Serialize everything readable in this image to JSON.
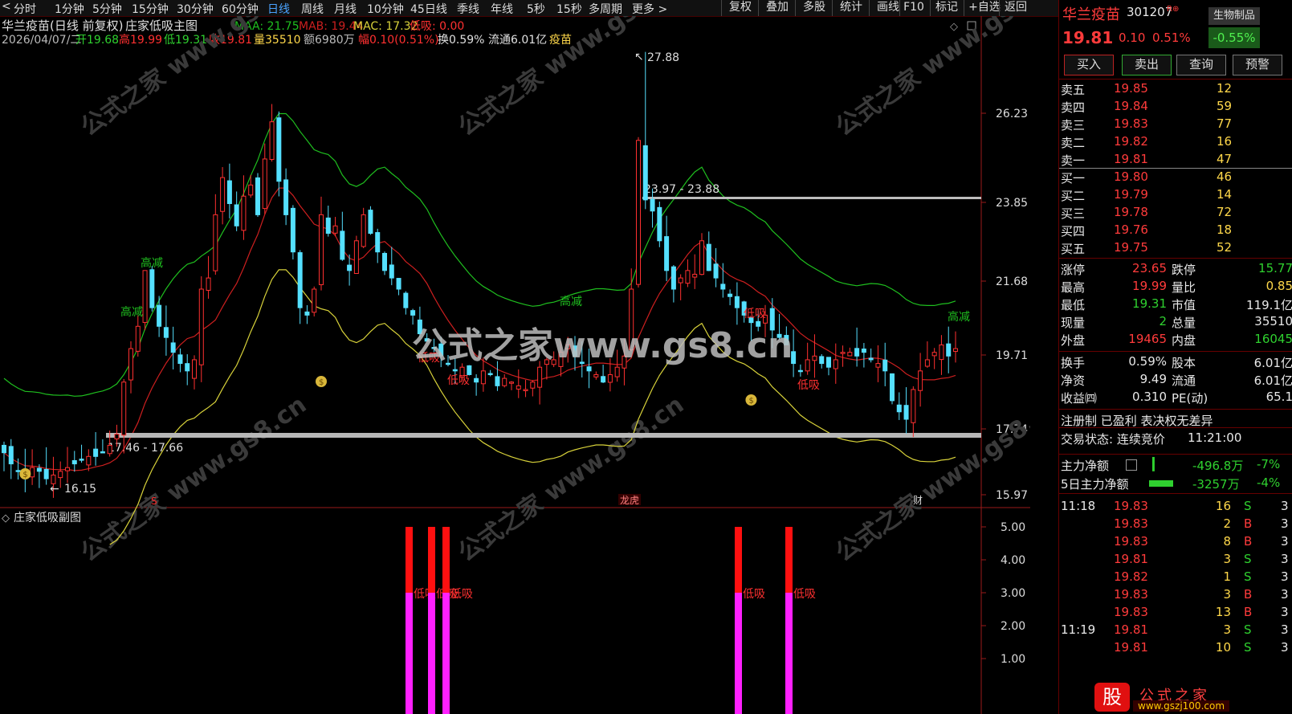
{
  "toolbar": {
    "left_icon": "<",
    "tabs": [
      "分时",
      "1分钟",
      "5分钟",
      "15分钟",
      "30分钟",
      "60分钟",
      "日线",
      "周线",
      "月线",
      "10分钟",
      "45日线",
      "季线",
      "年线",
      "5秒",
      "15秒",
      "多周期",
      "更多 >"
    ],
    "active_tab": "日线",
    "right_buttons": [
      "复权",
      "叠加",
      "多股",
      "统计",
      "画线",
      "F10",
      "标记",
      "+自选",
      "返回"
    ]
  },
  "chart_header": {
    "stock_label": "华兰疫苗(日线 前复权)",
    "formula": "庄家低吸主图",
    "maa": "MAA: 21.75",
    "mab": "MAB: 19.44",
    "mac": "MAC: 17.32",
    "dixi": "低吸: 0.00",
    "date": "2026/04/07/二",
    "open": "开19.68",
    "high": "高19.99",
    "low": "低19.31",
    "close": "收19.81",
    "volume": "量35510",
    "amount": "额6980万",
    "range": "幅0.10(0.51%)",
    "turnover": "换0.59%",
    "float": "流通6.01亿",
    "concept": "疫苗"
  },
  "price_axis": [
    "26.23",
    "23.85",
    "21.68",
    "19.71",
    "17.74",
    "15.97"
  ],
  "annotations": {
    "high_price": "27.88",
    "low_price": "16.15",
    "upper_band_label": "23.97 - 23.88",
    "lower_band_label": "17.46 - 17.66",
    "gaojian": "高减",
    "dixi": "低吸",
    "bottom_flags": [
      "S",
      "龙虎",
      "财"
    ],
    "watermark_text": "公式之家www.gs8.cn",
    "watermark_small": "公式之家 www.gs8.cn"
  },
  "sub_chart": {
    "title": "庄家低吸副图",
    "axis": [
      "5.00",
      "4.00",
      "3.00",
      "2.00",
      "1.00"
    ],
    "bar_label": "低吸"
  },
  "colors": {
    "candle_up": "#ff3030",
    "candle_down": "#55e0ff",
    "ma_green": "#1fbf1f",
    "ma_red": "#cc1f1f",
    "ma_yellow": "#d8d23a",
    "bar_red": "#ff1010",
    "bar_magenta": "#ff20ff"
  },
  "chart_data": {
    "type": "candlestick",
    "x": [
      0,
      1,
      2,
      3,
      4,
      5,
      6,
      7,
      8,
      9,
      10,
      11,
      12,
      13,
      14,
      15,
      16,
      17,
      18,
      19,
      20,
      21,
      22,
      23,
      24,
      25,
      26,
      27,
      28,
      29,
      30,
      31,
      32,
      33,
      34,
      35,
      36,
      37,
      38,
      39,
      40,
      41,
      42,
      43,
      44,
      45,
      46,
      47,
      48,
      49,
      50,
      51,
      52,
      53,
      54,
      55,
      56,
      57,
      58,
      59,
      60,
      61,
      62,
      63,
      64,
      65,
      66,
      67,
      68,
      69,
      70,
      71,
      72,
      73,
      74,
      75,
      76,
      77,
      78,
      79,
      80,
      81,
      82,
      83,
      84,
      85,
      86,
      87,
      88,
      89,
      90,
      91,
      92,
      93,
      94,
      95,
      96,
      97,
      98,
      99,
      100,
      101,
      102,
      103,
      104,
      105,
      106,
      107,
      108,
      109,
      110,
      111,
      112,
      113,
      114,
      115,
      116,
      117,
      118,
      119,
      120,
      121,
      122,
      123,
      124,
      125,
      126,
      127,
      128,
      129,
      130,
      131,
      132,
      133,
      134,
      135,
      136,
      137,
      138,
      139,
      140,
      141,
      142,
      143,
      144,
      145,
      146,
      147,
      148,
      149,
      150,
      151,
      152,
      153,
      154,
      155,
      156,
      157,
      158,
      159,
      160,
      161,
      162,
      163,
      164,
      165,
      166,
      167,
      168,
      169,
      170,
      171,
      172,
      173,
      174,
      175,
      176,
      177,
      178,
      179,
      180
    ],
    "close": [
      17.1,
      16.8,
      16.6,
      16.5,
      16.7,
      16.6,
      16.4,
      16.5,
      16.6,
      16.7,
      16.8,
      16.9,
      17.0,
      17.0,
      17.1,
      17.3,
      17.6,
      19.0,
      19.9,
      20.5,
      22.0,
      21.0,
      20.5,
      20.2,
      19.8,
      19.5,
      19.3,
      19.6,
      21.5,
      21.8,
      23.5,
      24.5,
      23.8,
      23.2,
      24.0,
      24.3,
      23.5,
      25.0,
      26.0,
      24.4,
      23.5,
      22.5,
      21.0,
      20.8,
      21.5,
      23.5,
      23.0,
      23.2,
      22.3,
      22.0,
      22.8,
      23.5,
      23.0,
      22.5,
      22.0,
      21.8,
      21.5,
      21.0,
      20.8,
      20.3,
      20.1,
      19.9,
      19.7,
      19.5,
      19.3,
      19.4,
      19.2,
      19.0,
      19.3,
      19.2,
      18.9,
      19.1,
      19.0,
      18.9,
      18.8,
      19.0,
      19.4,
      19.6,
      19.6,
      19.8,
      20.0,
      19.7,
      19.5,
      19.3,
      19.2,
      19.0,
      19.2,
      19.4,
      19.7,
      21.5,
      25.5,
      23.9,
      23.6,
      22.8,
      22.0,
      21.5,
      21.8,
      22.0,
      21.9,
      22.8,
      22.0,
      21.8,
      21.5,
      21.3,
      21.0,
      20.8,
      20.6,
      20.5,
      20.8,
      20.4,
      20.2,
      20.0,
      19.5,
      19.3,
      19.6,
      19.7,
      19.5,
      19.4,
      19.6,
      19.8,
      19.8,
      19.7,
      19.8,
      19.6,
      19.5,
      19.3,
      18.5,
      18.2,
      18.0,
      18.8,
      19.3,
      19.6,
      19.8,
      20.0,
      19.7,
      19.9
    ],
    "ylim": [
      15.97,
      28.5
    ]
  }
}
